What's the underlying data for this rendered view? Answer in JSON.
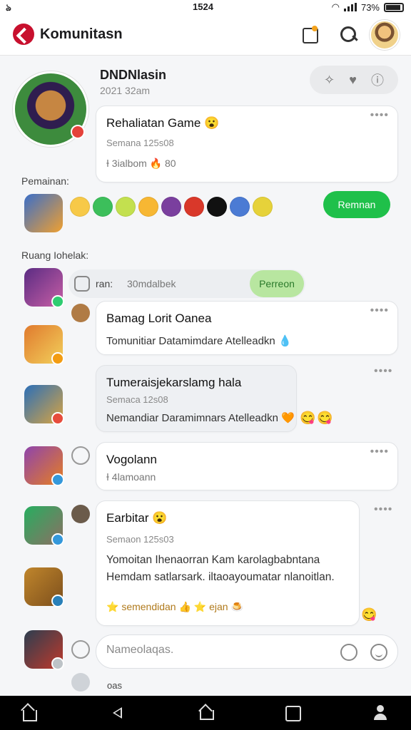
{
  "status_bar": {
    "left": "ঌ",
    "time": "1524",
    "battery": "73%"
  },
  "header": {
    "title": "Komunitasn"
  },
  "profile": {
    "name": "DNDNlasin",
    "date": "2021 32am"
  },
  "post1": {
    "title": "Rehaliatan Game 😮",
    "sub": "Semana 125s08",
    "meta": "Ɨ 3ialbom 🔥 80"
  },
  "section1": "Pemainan:",
  "join_button": "Remnan",
  "section2": "Ruang Iohelak:",
  "tab_row": {
    "a": "ran:",
    "b": "30mdalbek",
    "pill": "Perreon"
  },
  "post2": {
    "title": "Bamag Lorit Oanea",
    "line": "Tomunitiar Datamimdare Atelleadkn 💧"
  },
  "post3": {
    "title": "Tumeraisjekarslamg hala",
    "sub": "Semaca 12s08",
    "line": "Nemandiar Daramimnars Atelleadkn 🧡"
  },
  "post4": {
    "title": "Vogolann",
    "meta": "Ɨ 4lamoann"
  },
  "post5": {
    "title": "Earbitar 😮",
    "sub": "Semaon 125s03",
    "body1": "Yomoitan Ihenaorran Kam karolagbabntana",
    "body2": "Hemdam satlarsark. iltaoayoumatar nlanoitlan.",
    "footer": "⭐ semendidan 👍 ⭐ ejan 🍮"
  },
  "composer": {
    "placeholder": "Nameolaqas."
  },
  "footer_text": "oas",
  "colors": {
    "accent_green": "#1fc04a",
    "brand_red": "#c8102e"
  }
}
